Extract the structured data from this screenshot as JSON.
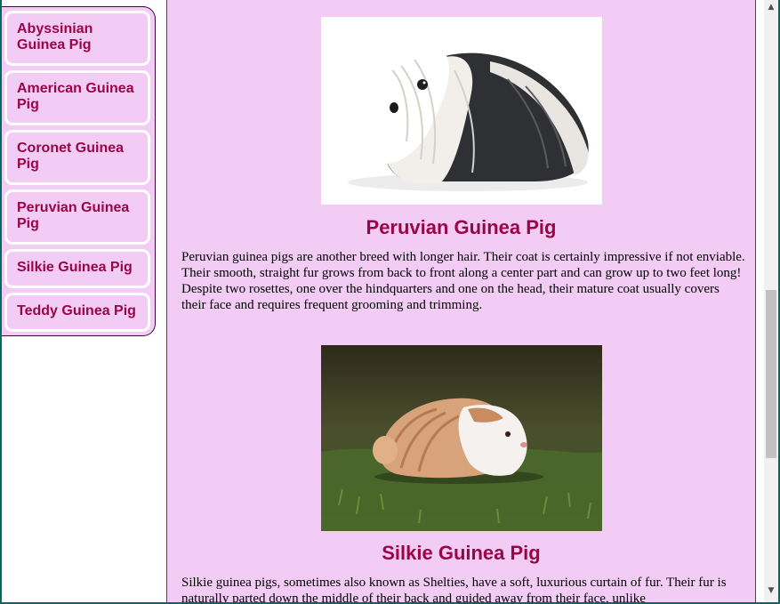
{
  "sidebar": {
    "items": [
      {
        "label": "Abyssinian Guinea Pig"
      },
      {
        "label": "American Guinea Pig"
      },
      {
        "label": "Coronet Guinea Pig"
      },
      {
        "label": "Peruvian Guinea Pig"
      },
      {
        "label": "Silkie Guinea Pig"
      },
      {
        "label": "Teddy Guinea Pig"
      }
    ]
  },
  "breeds": [
    {
      "title": "Peruvian Guinea Pig",
      "text": "Peruvian guinea pigs are another breed with longer hair. Their coat is certainly impressive if not enviable. Their smooth, straight fur grows from back to front along a center part and can grow up to two feet long! Despite two rosettes, one over the hindquarters and one on the head, their mature coat usually covers their face and requires frequent grooming and trimming."
    },
    {
      "title": "Silkie Guinea Pig",
      "text": "Silkie guinea pigs, sometimes also known as Shelties, have a soft, luxurious curtain of fur. Their fur is naturally parted down the middle of their back and guided away from their face, unlike"
    }
  ],
  "scrollbar": {
    "up_icon": "triangle-up-icon",
    "down_icon": "triangle-down-icon"
  },
  "colors": {
    "accent": "#9a0645",
    "panel": "#f3ccf6",
    "frame": "#006b5e"
  }
}
